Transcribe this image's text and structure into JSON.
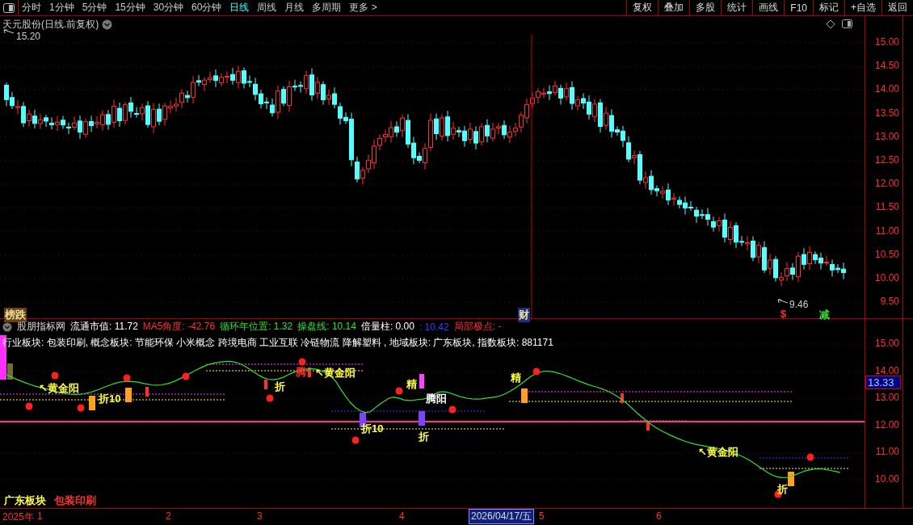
{
  "toolbar": {
    "tabs": [
      {
        "label": "分时",
        "selected": false
      },
      {
        "label": "1分钟",
        "selected": false
      },
      {
        "label": "5分钟",
        "selected": false
      },
      {
        "label": "15分钟",
        "selected": false
      },
      {
        "label": "30分钟",
        "selected": false
      },
      {
        "label": "60分钟",
        "selected": false
      },
      {
        "label": "日线",
        "selected": true
      },
      {
        "label": "周线",
        "selected": false
      },
      {
        "label": "月线",
        "selected": false
      },
      {
        "label": "多周期",
        "selected": false
      },
      {
        "label": "更多 >",
        "selected": false
      }
    ],
    "buttons": [
      "复权",
      "叠加",
      "多股",
      "统计",
      "画线",
      "F10",
      "标记",
      "+自选",
      "返回"
    ]
  },
  "price_panel": {
    "title": "天元股份(日线.前复权)",
    "high_label": "15.20",
    "low_label": "9.46",
    "markers": [
      {
        "text": "榜跌",
        "kind": "tag",
        "color": "#6a4010"
      },
      {
        "text": "财",
        "kind": "tag",
        "color": "#203080"
      },
      {
        "text": "$",
        "kind": "text",
        "color": "#ff3030"
      },
      {
        "text": "减",
        "kind": "text",
        "color": "#30e030"
      }
    ],
    "axis": [
      "15.00",
      "14.50",
      "14.00",
      "13.50",
      "13.00",
      "12.50",
      "12.00",
      "11.50",
      "11.00",
      "10.50",
      "10.00",
      "9.50"
    ]
  },
  "indicator_panel": {
    "name": "股朋指标网",
    "fields": [
      {
        "text": "流通市值: 11.72",
        "color": "#ffffff"
      },
      {
        "text": "MA5角度: -42.76",
        "color": "#ff3030"
      },
      {
        "text": "循环年位置: 1.32",
        "color": "#30e030"
      },
      {
        "text": "操盘线: 10.14",
        "color": "#30e030"
      },
      {
        "text": "倍量柱: 0.00",
        "color": "#ffffff"
      },
      {
        "text": ": 10.42",
        "color": "#3040ff"
      },
      {
        "text": "局部极点: -",
        "color": "#ff3030"
      }
    ],
    "sectors": "行业板块: 包装印刷, 概念板块: 节能环保 小米概念 跨境电商 工业互联 冷链物流 降解塑料 , 地域板块: 广东板块, 指数板块: 881171",
    "annotations": [
      {
        "text": "↖黄金阳",
        "color": "#ffff40"
      },
      {
        "text": "折10",
        "color": "#ffff40"
      },
      {
        "text": "折",
        "color": "#ffff40"
      },
      {
        "text": "腾",
        "color": "#ff3030"
      },
      {
        "text": "↖黄金阳",
        "color": "#ffff40"
      },
      {
        "text": "折10",
        "color": "#ffff40"
      },
      {
        "text": "精",
        "color": "#ffff40"
      },
      {
        "text": "腾阳",
        "color": "#ffffff"
      },
      {
        "text": "折",
        "color": "#ffff40"
      },
      {
        "text": "精",
        "color": "#ffff40"
      },
      {
        "text": "↖黄金阳",
        "color": "#ffff40"
      },
      {
        "text": "折",
        "color": "#ffff40"
      }
    ],
    "footer_tags": [
      {
        "text": "广东板块",
        "color": "#ffff40"
      },
      {
        "text": "包装印刷",
        "color": "#ff3030"
      }
    ],
    "axis": [
      "15.00",
      "14.00",
      "13.00",
      "12.00",
      "11.00",
      "10.00"
    ],
    "current_value": "13.33"
  },
  "time_axis": [
    {
      "text": "2025年",
      "selected": false
    },
    {
      "text": "1",
      "selected": false
    },
    {
      "text": "2",
      "selected": false
    },
    {
      "text": "3",
      "selected": false
    },
    {
      "text": "4",
      "selected": false
    },
    {
      "text": "2026/04/17/五",
      "selected": true
    },
    {
      "text": "5",
      "selected": false
    },
    {
      "text": "6",
      "selected": false
    }
  ]
}
